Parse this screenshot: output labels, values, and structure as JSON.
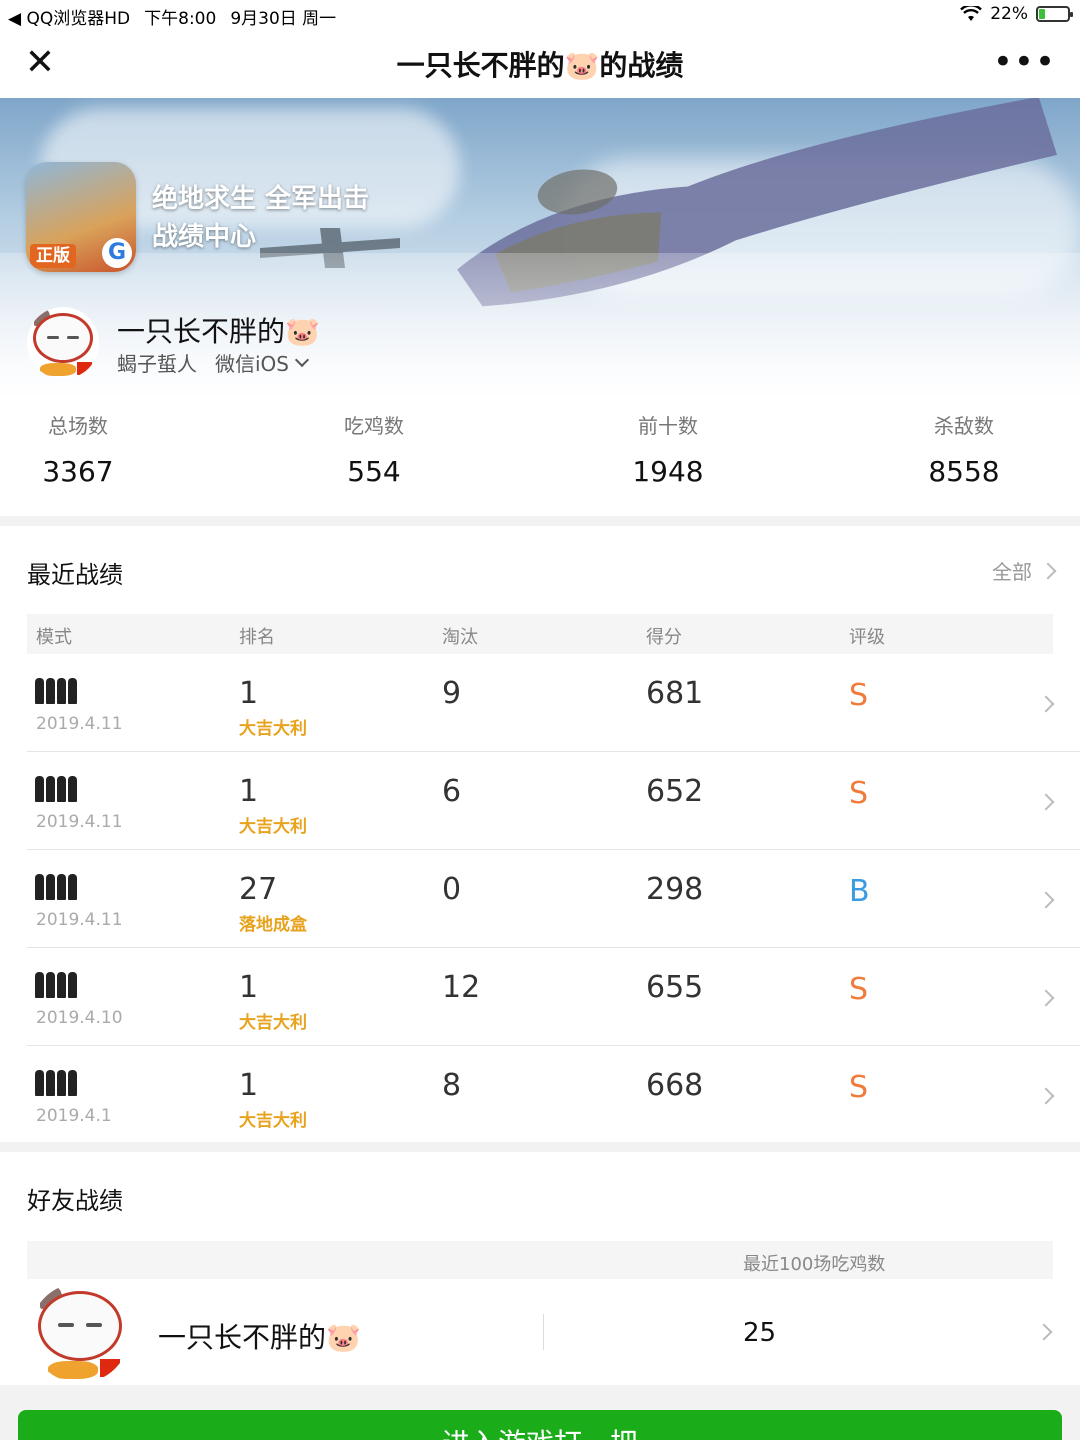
{
  "status_bar": {
    "app": "◀ QQ浏览器HD",
    "time": "下午8:00",
    "date": "9月30日 周一",
    "battery": "22%",
    "battery_level": 0.22
  },
  "nav": {
    "title": "一只长不胖的🐷的战绩"
  },
  "banner": {
    "app_tag": "正版",
    "app_title_line1": "绝地求生 全军出击",
    "app_title_line2": "战绩中心"
  },
  "profile": {
    "name": "一只长不胖的🐷",
    "rank_title": "蝎子蜇人",
    "platform": "微信iOS"
  },
  "stats": [
    {
      "label": "总场数",
      "value": "3367"
    },
    {
      "label": "吃鸡数",
      "value": "554"
    },
    {
      "label": "前十数",
      "value": "1948"
    },
    {
      "label": "杀敌数",
      "value": "8558"
    }
  ],
  "recent": {
    "title": "最近战绩",
    "all_link": "全部",
    "headers": [
      "模式",
      "排名",
      "淘汰",
      "得分",
      "评级"
    ],
    "rows": [
      {
        "date": "2019.4.11",
        "rank": "1",
        "rank_label": "大吉大利",
        "kills": "9",
        "score": "681",
        "grade": "S"
      },
      {
        "date": "2019.4.11",
        "rank": "1",
        "rank_label": "大吉大利",
        "kills": "6",
        "score": "652",
        "grade": "S"
      },
      {
        "date": "2019.4.11",
        "rank": "27",
        "rank_label": "落地成盒",
        "kills": "0",
        "score": "298",
        "grade": "B"
      },
      {
        "date": "2019.4.10",
        "rank": "1",
        "rank_label": "大吉大利",
        "kills": "12",
        "score": "655",
        "grade": "S"
      },
      {
        "date": "2019.4.1",
        "rank": "1",
        "rank_label": "大吉大利",
        "kills": "8",
        "score": "668",
        "grade": "S"
      }
    ]
  },
  "friends": {
    "title": "好友战绩",
    "column_header": "最近100场吃鸡数",
    "rows": [
      {
        "name": "一只长不胖的🐷",
        "value": "25"
      }
    ]
  },
  "enter_button": "进入游戏打一把",
  "colors": {
    "grade_S": "#f07c3c",
    "grade_B": "#3a9be0",
    "rank_label": "#e8a31e",
    "button_green": "#1aad19"
  },
  "icons": {
    "close": "close-icon",
    "more": "more-dots-icon",
    "mode": "squad-icon",
    "chevron": "chevron-right-icon"
  }
}
